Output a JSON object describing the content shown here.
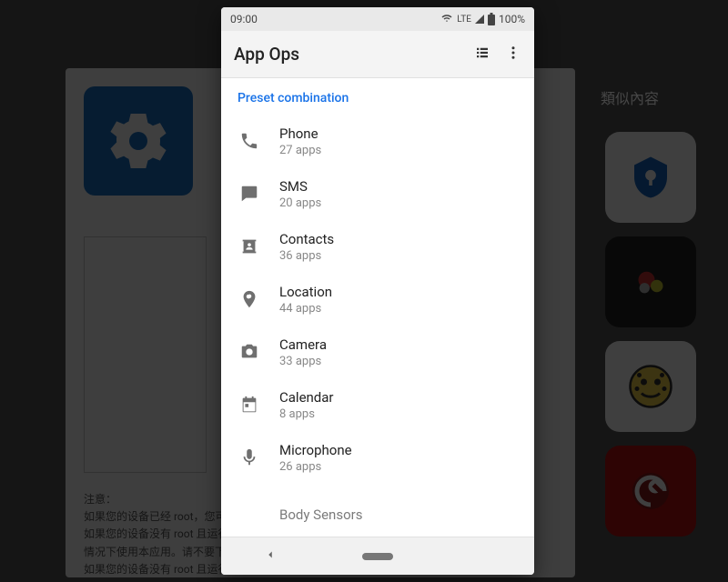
{
  "statusbar": {
    "time": "09:00",
    "network": "LTE",
    "battery": "100%"
  },
  "appbar": {
    "title": "App Ops"
  },
  "section_header": "Preset combination",
  "permissions": [
    {
      "icon": "phone-icon",
      "label": "Phone",
      "sub": "27 apps"
    },
    {
      "icon": "sms-icon",
      "label": "SMS",
      "sub": "20 apps"
    },
    {
      "icon": "contacts-icon",
      "label": "Contacts",
      "sub": "36 apps"
    },
    {
      "icon": "location-icon",
      "label": "Location",
      "sub": "44 apps"
    },
    {
      "icon": "camera-icon",
      "label": "Camera",
      "sub": "33 apps"
    },
    {
      "icon": "calendar-icon",
      "label": "Calendar",
      "sub": "8 apps"
    },
    {
      "icon": "microphone-icon",
      "label": "Microphone",
      "sub": "26 apps"
    },
    {
      "icon": "sensors-icon",
      "label": "Body Sensors",
      "sub": ""
    }
  ],
  "backdrop": {
    "similar_title": "類似內容",
    "note_heading": "注意：",
    "note_line1": "如果您的设备已经 root，您可…",
    "note_line2": "如果您的设备没有 root 且运行…",
    "note_line3": "情况下使用本应用。请不要下…",
    "note_line4": "如果您的设备没有 root 且运行…"
  }
}
